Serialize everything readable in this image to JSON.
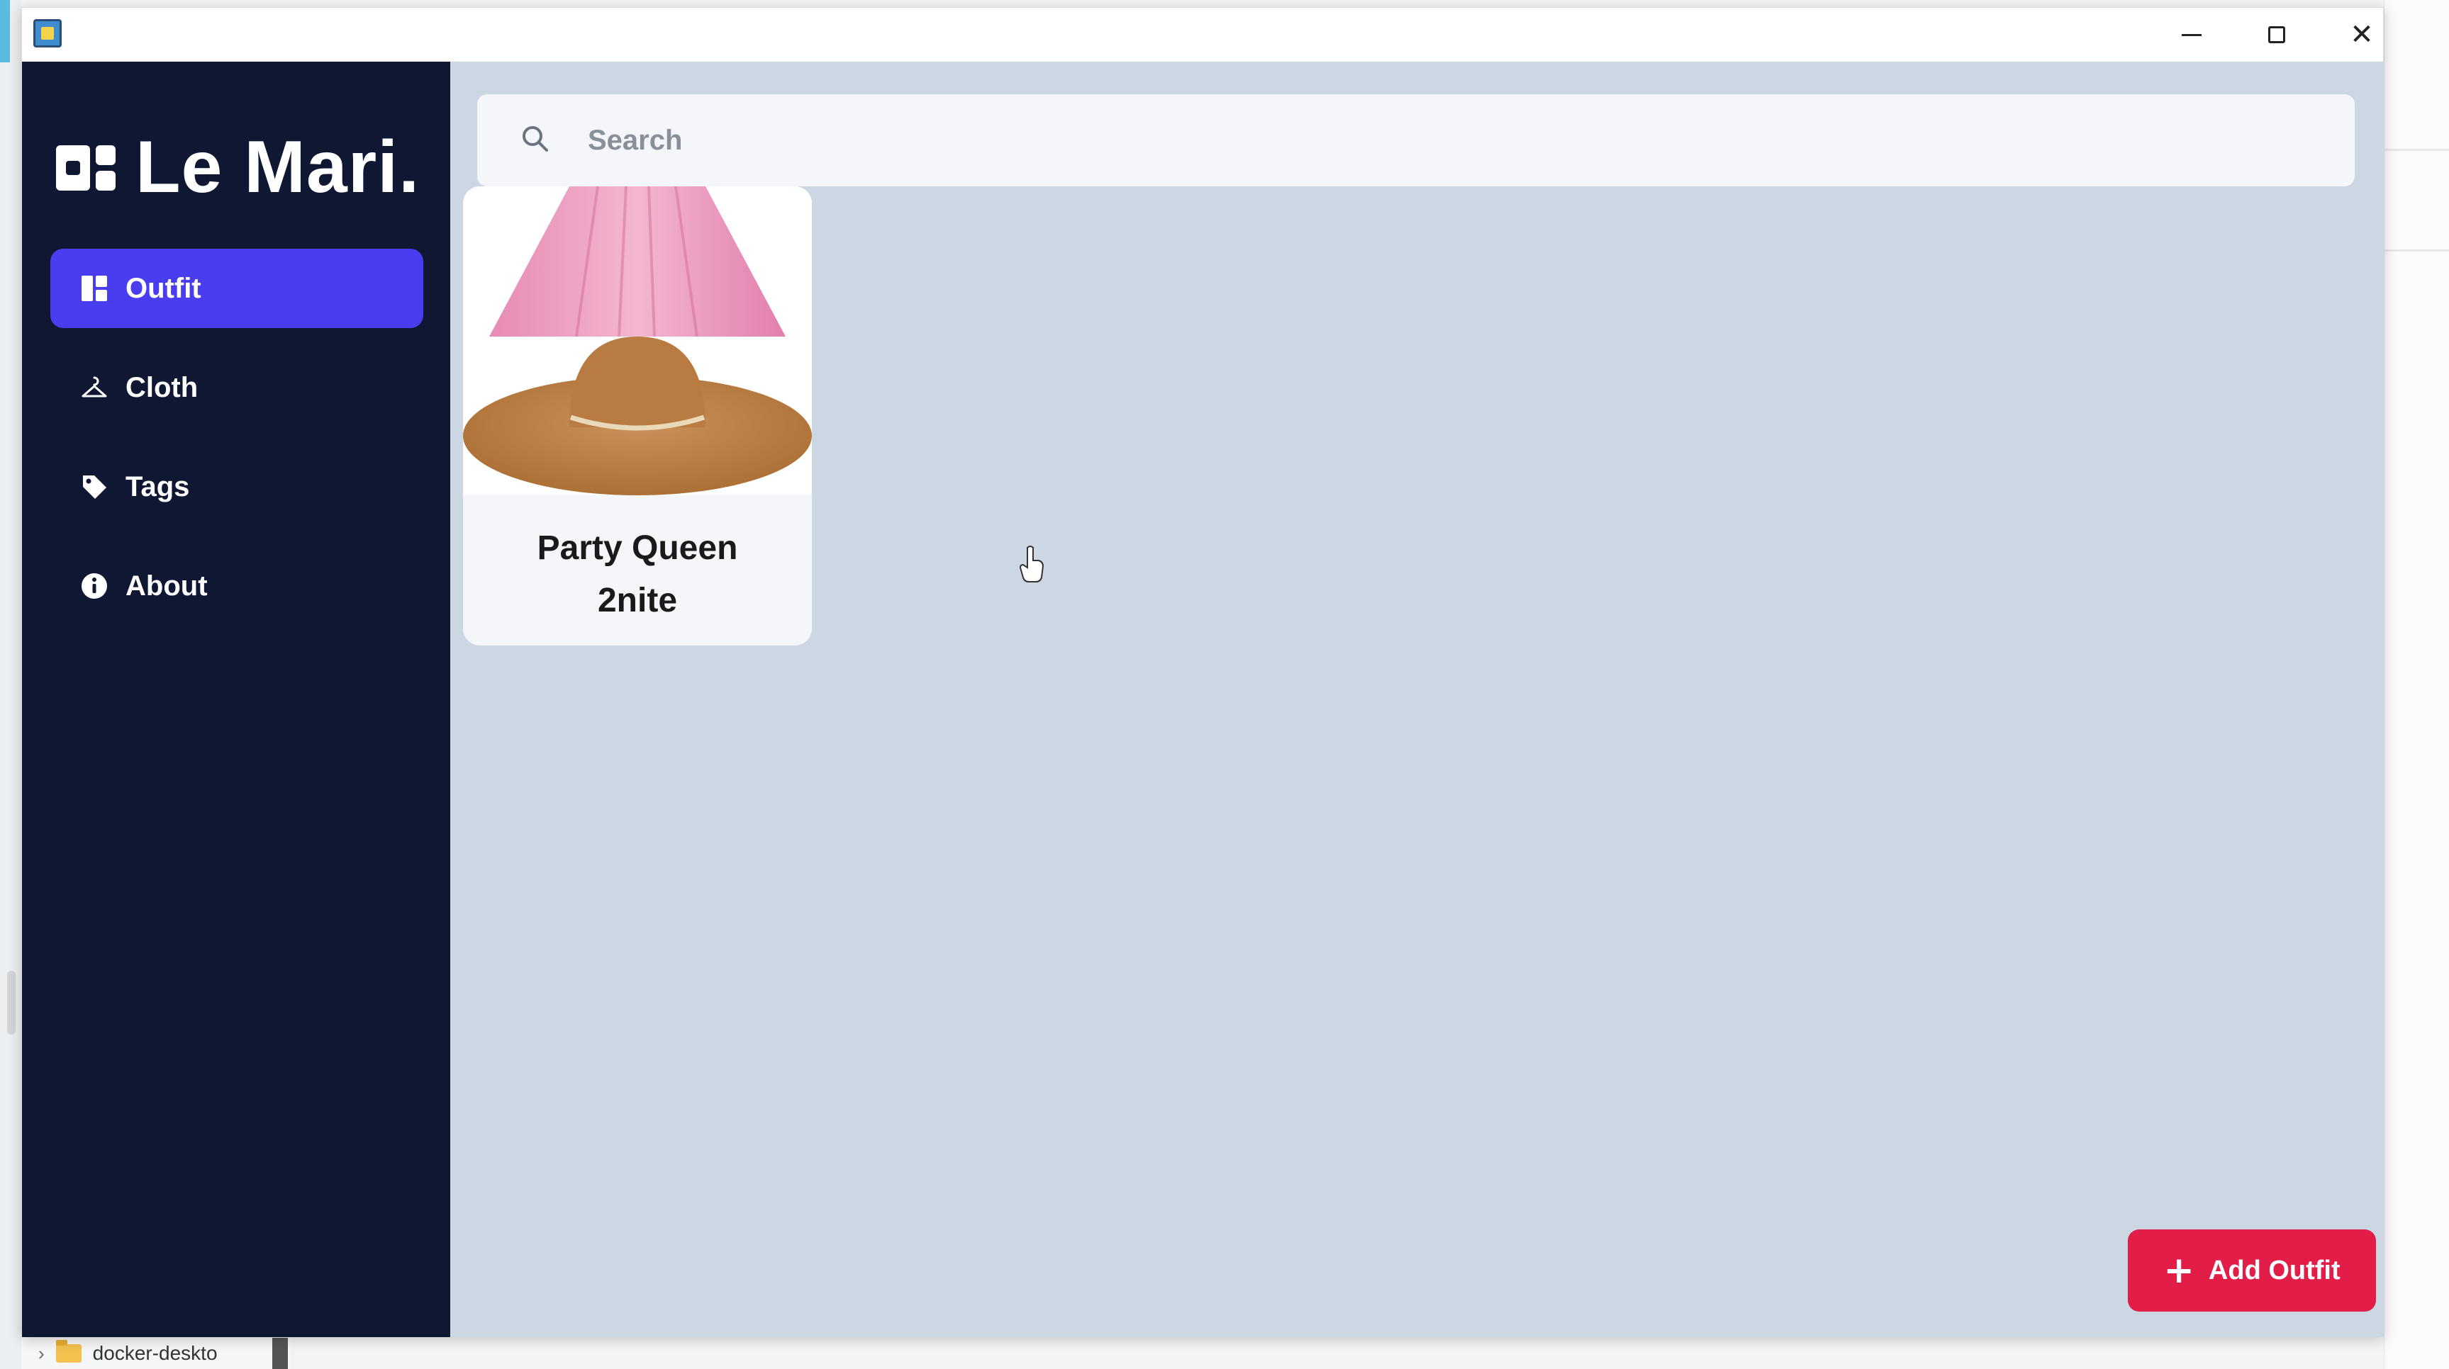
{
  "window": {
    "controls": {
      "minimize": "minimize",
      "maximize": "maximize",
      "close": "✕"
    }
  },
  "brand": {
    "name": "Le Mari."
  },
  "sidebar": {
    "items": [
      {
        "label": "Outfit",
        "icon": "dashboard-icon",
        "active": true
      },
      {
        "label": "Cloth",
        "icon": "hanger-icon",
        "active": false
      },
      {
        "label": "Tags",
        "icon": "tag-icon",
        "active": false
      },
      {
        "label": "About",
        "icon": "info-icon",
        "active": false
      }
    ]
  },
  "search": {
    "placeholder": "Search",
    "value": ""
  },
  "outfits": [
    {
      "title_line1": "Party Queen",
      "title_line2": "2nite"
    }
  ],
  "actions": {
    "add_outfit_label": "Add Outfit",
    "add_outfit_icon": "+"
  },
  "explorer": {
    "folder_label": "docker-deskto"
  },
  "colors": {
    "sidebar_bg": "#0f1732",
    "active_nav": "#4a3df0",
    "main_bg": "#cdd6e3",
    "add_button": "#e11d48"
  }
}
